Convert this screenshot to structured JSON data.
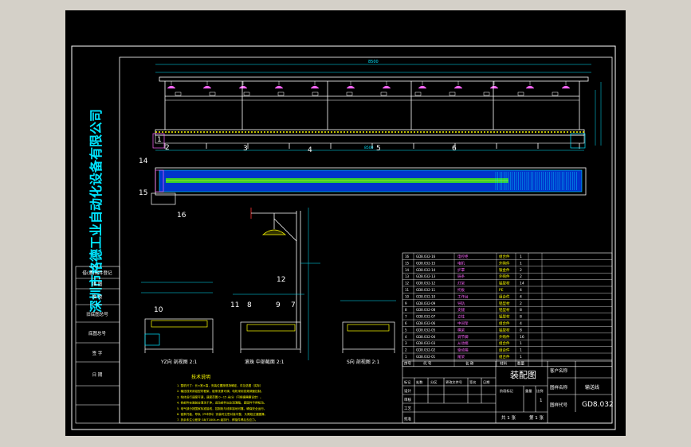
{
  "viewport": {
    "background_color": "#d4d0c8",
    "canvas_color": "#000000"
  },
  "colors": {
    "frame": "#ffffff",
    "company": "#00e5ff",
    "dims": "#00e5ff",
    "lines": "#ffffff",
    "guard_band": "#0033cc",
    "belt_core": "#33cc33",
    "lamp": "#ff66ff",
    "accent": "#ffff00",
    "leader": "#ff3333"
  },
  "company_name": "深圳市格德工业自动化设备有限公司",
  "left_panel": {
    "items": [
      "借(通)用件登记",
      "描  图",
      "描  校",
      "旧底图总号",
      "底图总号",
      "签  字",
      "日  期"
    ]
  },
  "callouts": [
    "1",
    "2",
    "3",
    "4",
    "5",
    "6",
    "14",
    "15",
    "16",
    "12",
    "11",
    "8",
    "10",
    "9",
    "7"
  ],
  "section_titles": {
    "left": "YZ向 剖视图 2:1",
    "middle": "滚珠 中部截面 2:1",
    "right": "S向 剖视图 2:1"
  },
  "notes": {
    "title": "技术说明",
    "lines": [
      "1. 整机尺寸：长×宽×高，安装位置按现场确定，详见总图（实际）",
      "2. 输送线采用铝型材框架，链条张紧可调，电机采用变频调速控制。",
      "3. 线体运行速度可调，速度范围 0~15 米/分（可根据需要设定）。",
      "4. 各部件安装前应清洗干净，运动部件加注润滑脂，紧固件不得松动。",
      "5. 电气部分按国家标准接线，控制柜与线体接地可靠，确保安全运行。",
      "6. 链条托板，导轨（PE材料）安装时注意对接平整，头尾段过渡圆滑。",
      "7. 其余未注公差按 GB/T1804-m 级执行，焊接件焊后去应力。"
    ]
  },
  "bom": {
    "rows": [
      {
        "no": "16",
        "code": "GD8.032-16",
        "name": "电控柜",
        "mat": "组合件",
        "qty": "1"
      },
      {
        "no": "15",
        "code": "GD8.032-15",
        "name": "电机",
        "mat": "外购件",
        "qty": "1"
      },
      {
        "no": "14",
        "code": "GD8.032-14",
        "name": "护罩",
        "mat": "钣金件",
        "qty": "2"
      },
      {
        "no": "13",
        "code": "GD8.032-13",
        "name": "链条",
        "mat": "外购件",
        "qty": "2"
      },
      {
        "no": "12",
        "code": "GD8.032-12",
        "name": "灯架",
        "mat": "铝型材",
        "qty": "14"
      },
      {
        "no": "11",
        "code": "GD8.032-11",
        "name": "托板",
        "mat": "PE",
        "qty": "4"
      },
      {
        "no": "10",
        "code": "GD8.032-10",
        "name": "工作台",
        "mat": "组合件",
        "qty": "4"
      },
      {
        "no": "9",
        "code": "GD8.032-09",
        "name": "导轨",
        "mat": "铝型材",
        "qty": "2"
      },
      {
        "no": "8",
        "code": "GD8.032-08",
        "name": "支腿",
        "mat": "铝型材",
        "qty": "8"
      },
      {
        "no": "7",
        "code": "GD8.032-07",
        "name": "立柱",
        "mat": "铝型材",
        "qty": "8"
      },
      {
        "no": "6",
        "code": "GD8.032-06",
        "name": "中间架",
        "mat": "组合件",
        "qty": "4"
      },
      {
        "no": "5",
        "code": "GD8.032-05",
        "name": "横梁",
        "mat": "铝型材",
        "qty": "8"
      },
      {
        "no": "4",
        "code": "GD8.032-04",
        "name": "调节脚",
        "mat": "外购件",
        "qty": "16"
      },
      {
        "no": "3",
        "code": "GD8.032-03",
        "name": "从动端",
        "mat": "组合件",
        "qty": "1"
      },
      {
        "no": "2",
        "code": "GD8.032-02",
        "name": "驱动端",
        "mat": "组合件",
        "qty": "1"
      },
      {
        "no": "1",
        "code": "GD8.032-01",
        "name": "尾架",
        "mat": "组合件",
        "qty": "1"
      }
    ],
    "header": {
      "no": "序号",
      "code": "代 号",
      "name": "名 称",
      "mat": "材料",
      "qty": "数量"
    }
  },
  "title_block": {
    "drawing_type": "装配图",
    "client_label": "客户名称",
    "drawing_name_label": "图样名称",
    "drawing_name": "输送线",
    "drawing_code_label": "图样代号",
    "drawing_code": "GD8.032",
    "sheet_total": "共 1 张",
    "sheet_no": "第 1 张",
    "rev_labels": [
      "标记",
      "处数",
      "分区",
      "更改文件号",
      "签名",
      "日期"
    ],
    "sign_labels": [
      "设计",
      "审核",
      "工艺",
      "批准"
    ],
    "stage_labels": [
      "阶段标记",
      "重量",
      "比例"
    ],
    "scale": "1",
    "weight": ""
  }
}
